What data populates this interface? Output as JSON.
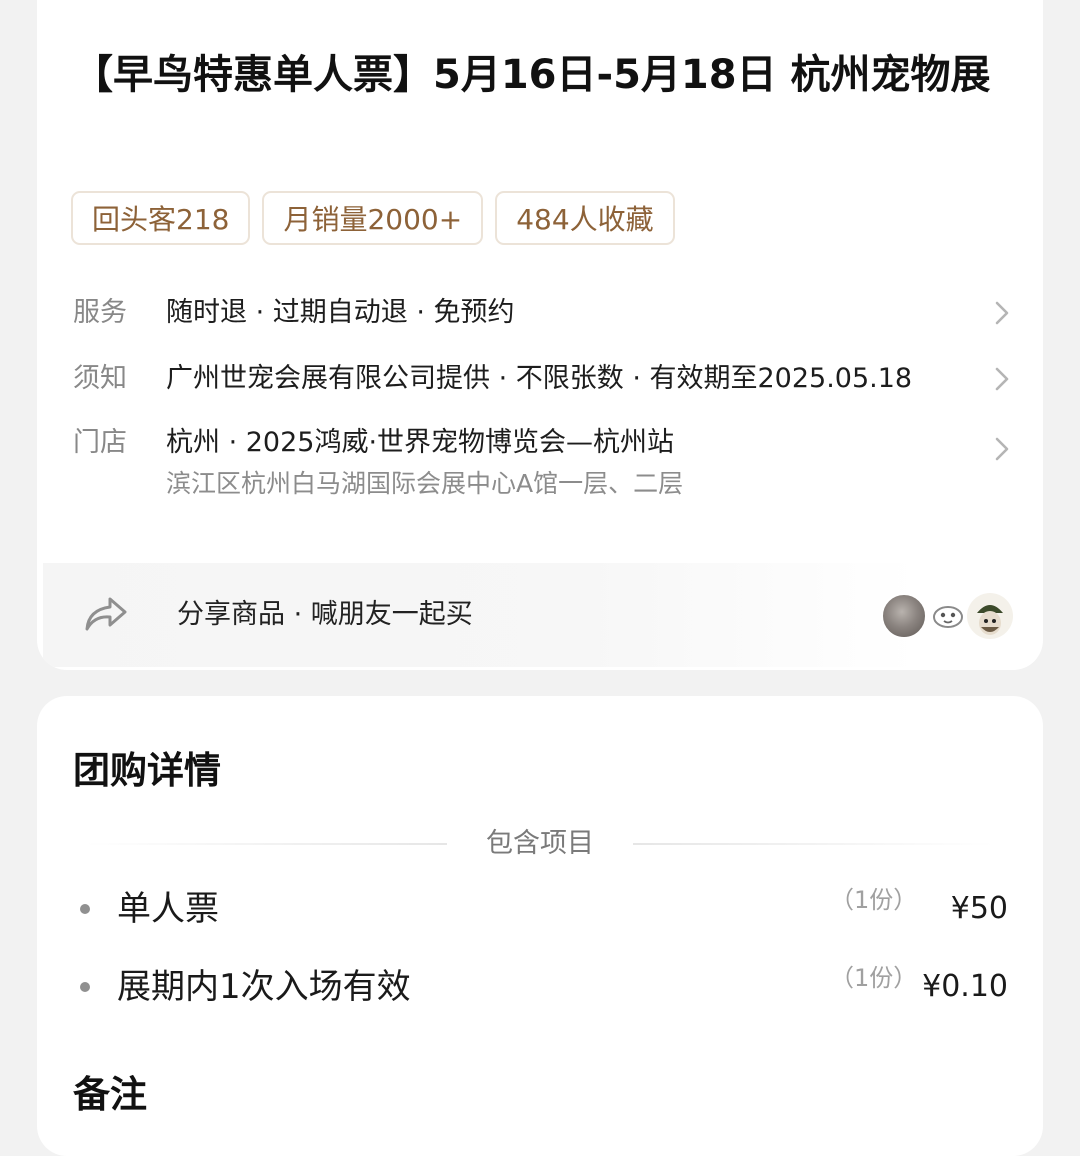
{
  "product": {
    "title": "【早鸟特惠单人票】5月16日-5月18日 杭州宠物展",
    "tags": [
      "回头客218",
      "月销量2000+",
      "484人收藏"
    ]
  },
  "info": {
    "service": {
      "label": "服务",
      "value": "随时退 · 过期自动退 · 免预约"
    },
    "notice": {
      "label": "须知",
      "value": "广州世宠会展有限公司提供 · 不限张数 · 有效期至2025.05.18"
    },
    "store": {
      "label": "门店",
      "value": "杭州 · 2025鸿威·世界宠物博览会—杭州站",
      "address": "滨江区杭州白马湖国际会展中心A馆一层、二层"
    }
  },
  "share": {
    "label": "分享商品 · 喊朋友一起买",
    "icon": "share-arrow-icon"
  },
  "group_detail": {
    "title": "团购详情",
    "included_label": "包含项目",
    "items": [
      {
        "name": "单人票",
        "qty": "（1份）",
        "price": "¥50"
      },
      {
        "name": "展期内1次入场有效",
        "qty": "（1份）",
        "price": "¥0.10"
      }
    ],
    "remark_title": "备注"
  },
  "colors": {
    "tag_text": "#8d6238",
    "tag_border": "#ece3d8",
    "label_gray": "#888888",
    "background": "#f2f2f2"
  }
}
